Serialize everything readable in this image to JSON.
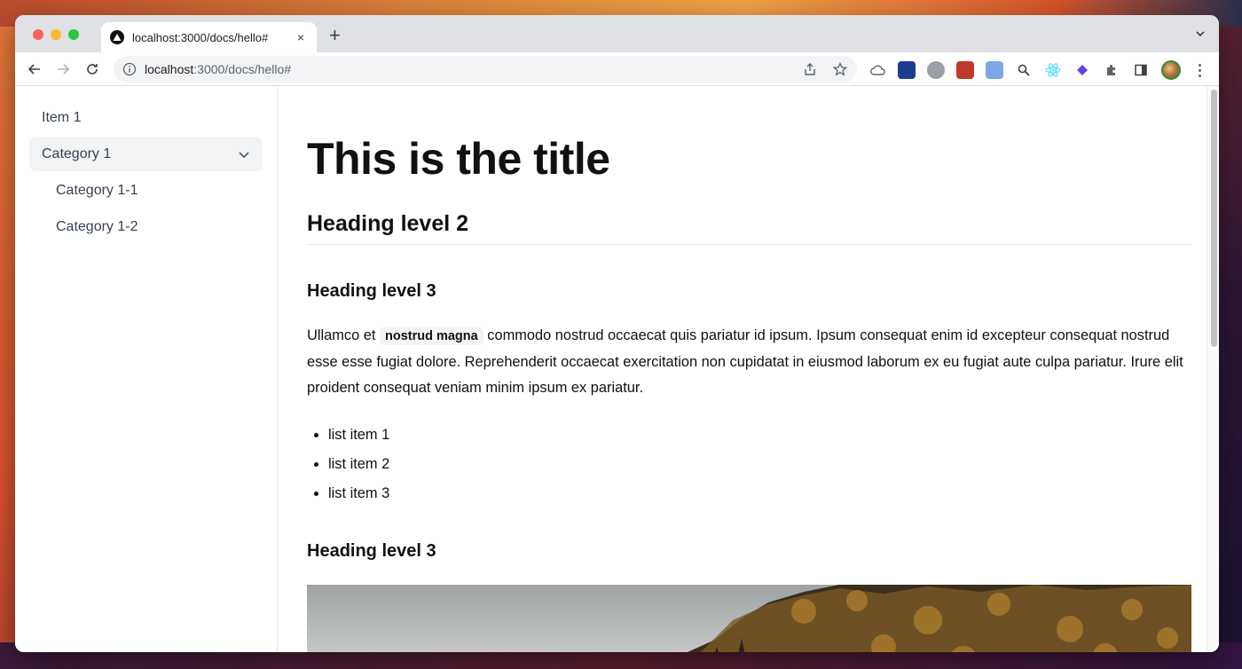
{
  "browser": {
    "tab": {
      "title": "localhost:3000/docs/hello#"
    },
    "new_tab_label": "+",
    "close_label": "×",
    "address": {
      "host": "localhost",
      "path": ":3000/docs/hello#"
    }
  },
  "sidebar": {
    "items": [
      {
        "label": "Item 1",
        "type": "item"
      },
      {
        "label": "Category 1",
        "type": "category",
        "expanded": true
      },
      {
        "label": "Category 1-1",
        "type": "sub"
      },
      {
        "label": "Category 1-2",
        "type": "sub"
      }
    ]
  },
  "doc": {
    "title": "This is the title",
    "heading2": "Heading level 2",
    "heading3a": "Heading level 3",
    "para_before": "Ullamco et ",
    "para_code": "nostrud magna",
    "para_after": " commodo nostrud occaecat quis pariatur id ipsum. Ipsum consequat enim id excepteur consequat nostrud esse esse fugiat dolore. Reprehenderit occaecat exercitation non cupidatat in eiusmod laborum ex eu fugiat aute culpa pariatur. Irure elit proident consequat veniam minim ipsum ex pariatur.",
    "list": [
      "list item 1",
      "list item 2",
      "list item 3"
    ],
    "heading3b": "Heading level 3"
  },
  "colors": {
    "sidebar_active_bg": "#f1f3f5",
    "text": "#111111",
    "sidebar_text": "#374151"
  }
}
